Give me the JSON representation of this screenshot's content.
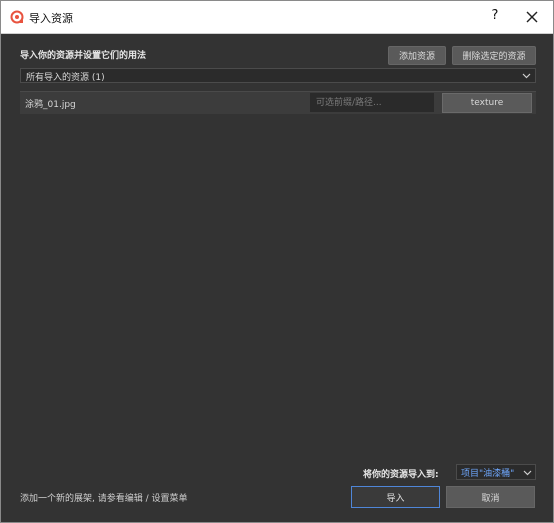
{
  "window": {
    "title": "导入资源",
    "help_label": "?",
    "accent_color": "#e8533f"
  },
  "header": {
    "heading": "导入你的资源并设置它们的用法",
    "add_button_label": "添加资源",
    "remove_button_label": "删除选定的资源"
  },
  "filter": {
    "selected": "所有导入的资源 (1)"
  },
  "assets": [
    {
      "name": "涂鸦_01.jpg",
      "path_placeholder": "可选前缀/路径...",
      "type_label": "texture"
    }
  ],
  "destination": {
    "label": "将你的资源导入到:",
    "selected": "项目\"油漆桶\"",
    "value_color": "#6fa8ff"
  },
  "footer": {
    "hint": "添加一个新的展架, 请参看编辑 / 设置菜单",
    "import_label": "导入",
    "cancel_label": "取消",
    "import_border_color": "#4f86d8"
  }
}
